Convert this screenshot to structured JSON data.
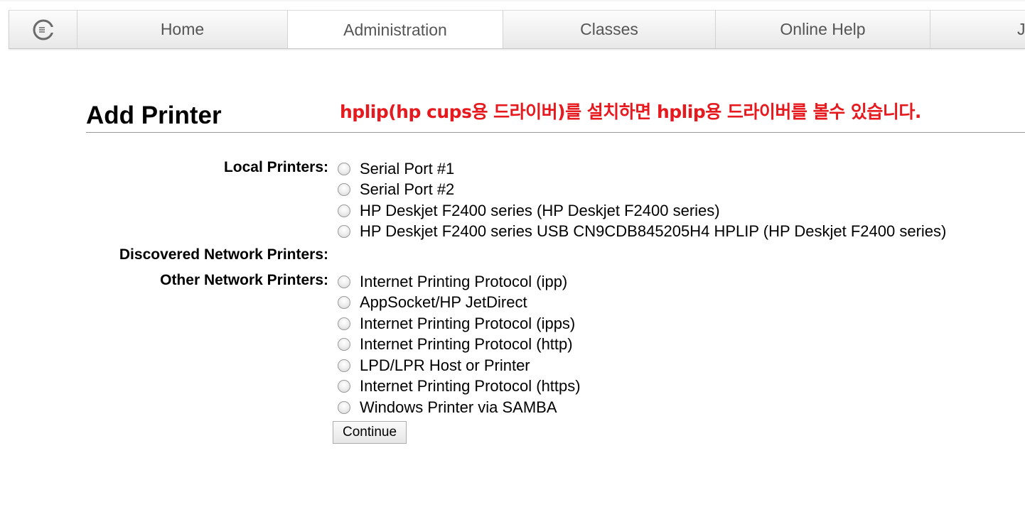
{
  "nav": {
    "tabs": [
      {
        "label": "Home"
      },
      {
        "label": "Administration"
      },
      {
        "label": "Classes"
      },
      {
        "label": "Online Help"
      },
      {
        "label": "J"
      }
    ],
    "active": "Administration",
    "logo_icon": "cups-logo-icon"
  },
  "page": {
    "title": "Add Printer",
    "note": "hplip(hp cups용 드라이버)를 설치하면 hplip용 드라이버를 볼수 있습니다.",
    "note_color": "#e6191e"
  },
  "local_printers": {
    "label": "Local Printers:",
    "options": [
      "Serial Port #1",
      "Serial Port #2",
      "HP Deskjet F2400 series (HP Deskjet F2400 series)",
      "HP Deskjet F2400 series USB CN9CDB845205H4 HPLIP (HP Deskjet F2400 series)"
    ]
  },
  "discovered_network_printers": {
    "label": "Discovered Network Printers:"
  },
  "other_network_printers": {
    "label": "Other Network Printers:",
    "options": [
      "Internet Printing Protocol (ipp)",
      "AppSocket/HP JetDirect",
      "Internet Printing Protocol (ipps)",
      "Internet Printing Protocol (http)",
      "LPD/LPR Host or Printer",
      "Internet Printing Protocol (https)",
      "Windows Printer via SAMBA"
    ]
  },
  "continue_label": "Continue"
}
